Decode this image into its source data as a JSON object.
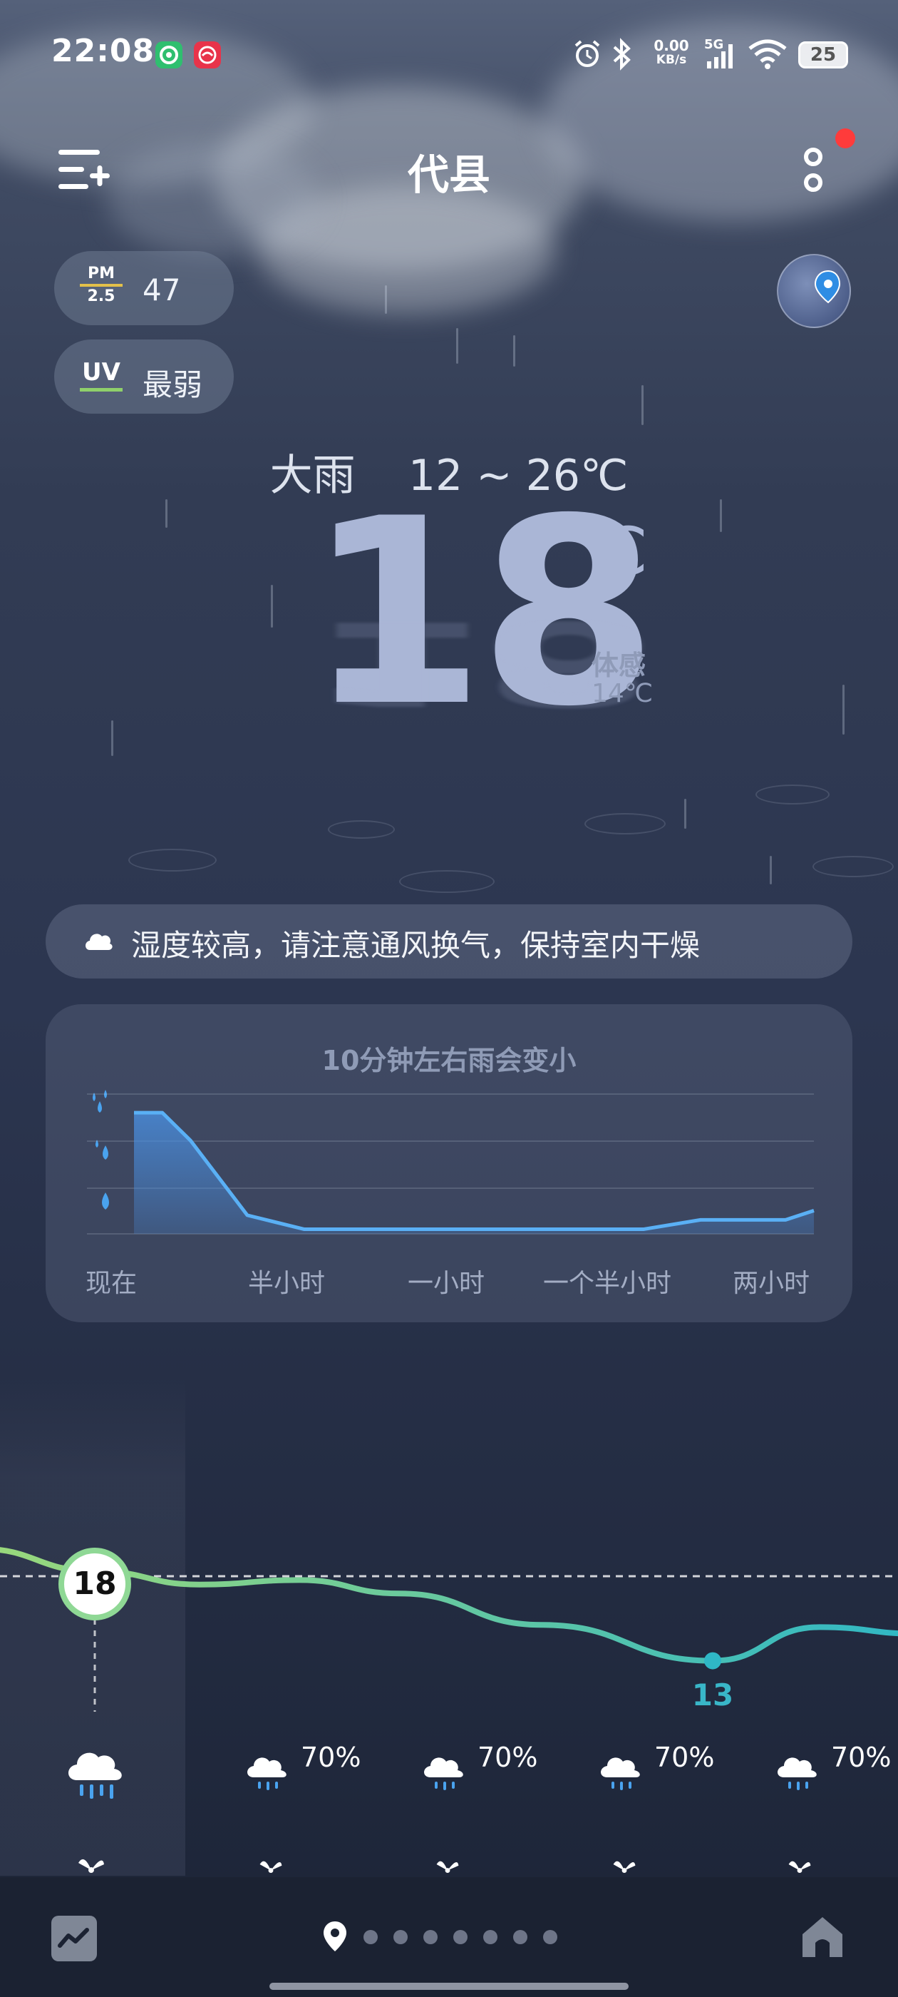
{
  "status_bar": {
    "time": "22:08",
    "net_speed_value": "0.00",
    "net_speed_unit": "KB/s",
    "signal_label": "5G",
    "battery": "25",
    "icons": [
      "wechat-app-icon",
      "red-app-icon",
      "alarm-icon",
      "bluetooth-icon",
      "signal-icon",
      "wifi-icon",
      "battery-icon"
    ]
  },
  "header": {
    "city": "代县",
    "menu_icon": "add-city-icon",
    "more_icon": "more-icon",
    "has_notification": true
  },
  "aqi": {
    "label_top": "PM",
    "label_bottom": "2.5",
    "value": "47",
    "accent": "#e3c04a"
  },
  "uv": {
    "label": "UV",
    "value": "最弱",
    "accent": "#8fd06b"
  },
  "current": {
    "condition": "大雨",
    "range": "12 ~ 26℃",
    "temp": "18",
    "unit": "℃",
    "feels_label": "体感",
    "feels_value": "14℃"
  },
  "tip": {
    "icon": "cloud-icon",
    "text": "湿度较高，请注意通风换气，保持室内干燥"
  },
  "rain_forecast": {
    "title": "10分钟左右雨会变小",
    "x_labels": [
      "现在",
      "半小时",
      "一小时",
      "一个半小时",
      "两小时"
    ],
    "intensity_icons": [
      "heavy-rain-drops-icon",
      "moderate-rain-drops-icon",
      "light-rain-drop-icon"
    ],
    "accent": "#4aa3ef"
  },
  "chart_data": {
    "type": "area",
    "title": "10分钟左右雨会变小",
    "x_tick_labels": [
      "现在",
      "半小时",
      "一小时",
      "一个半小时",
      "两小时"
    ],
    "x": [
      0,
      5,
      10,
      20,
      30,
      40,
      50,
      60,
      70,
      80,
      90,
      100,
      110,
      115,
      120
    ],
    "values": [
      2.6,
      2.6,
      2.0,
      0.4,
      0.1,
      0.1,
      0.1,
      0.1,
      0.1,
      0.1,
      0.1,
      0.3,
      0.3,
      0.3,
      0.5
    ],
    "ylim": [
      0,
      3
    ],
    "grid": true
  },
  "hourly": {
    "now_temp": "18",
    "low_temp": "13",
    "temps": [
      18,
      17,
      16.4,
      16.6,
      16,
      14.6,
      13,
      14.5,
      14.2
    ],
    "items": [
      {
        "icon": "rain-icon",
        "prob": ""
      },
      {
        "icon": "rain-icon",
        "prob": "70%"
      },
      {
        "icon": "rain-icon",
        "prob": "70%"
      },
      {
        "icon": "rain-icon",
        "prob": "70%"
      },
      {
        "icon": "rain-icon",
        "prob": "70%"
      }
    ],
    "accent_start": "#9bd97a",
    "accent_end": "#2fb7c6"
  },
  "bottom_nav": {
    "trend_icon": "trend-icon",
    "location_icon": "location-pin-icon",
    "page_count": 7,
    "home_icon": "home-icon"
  }
}
